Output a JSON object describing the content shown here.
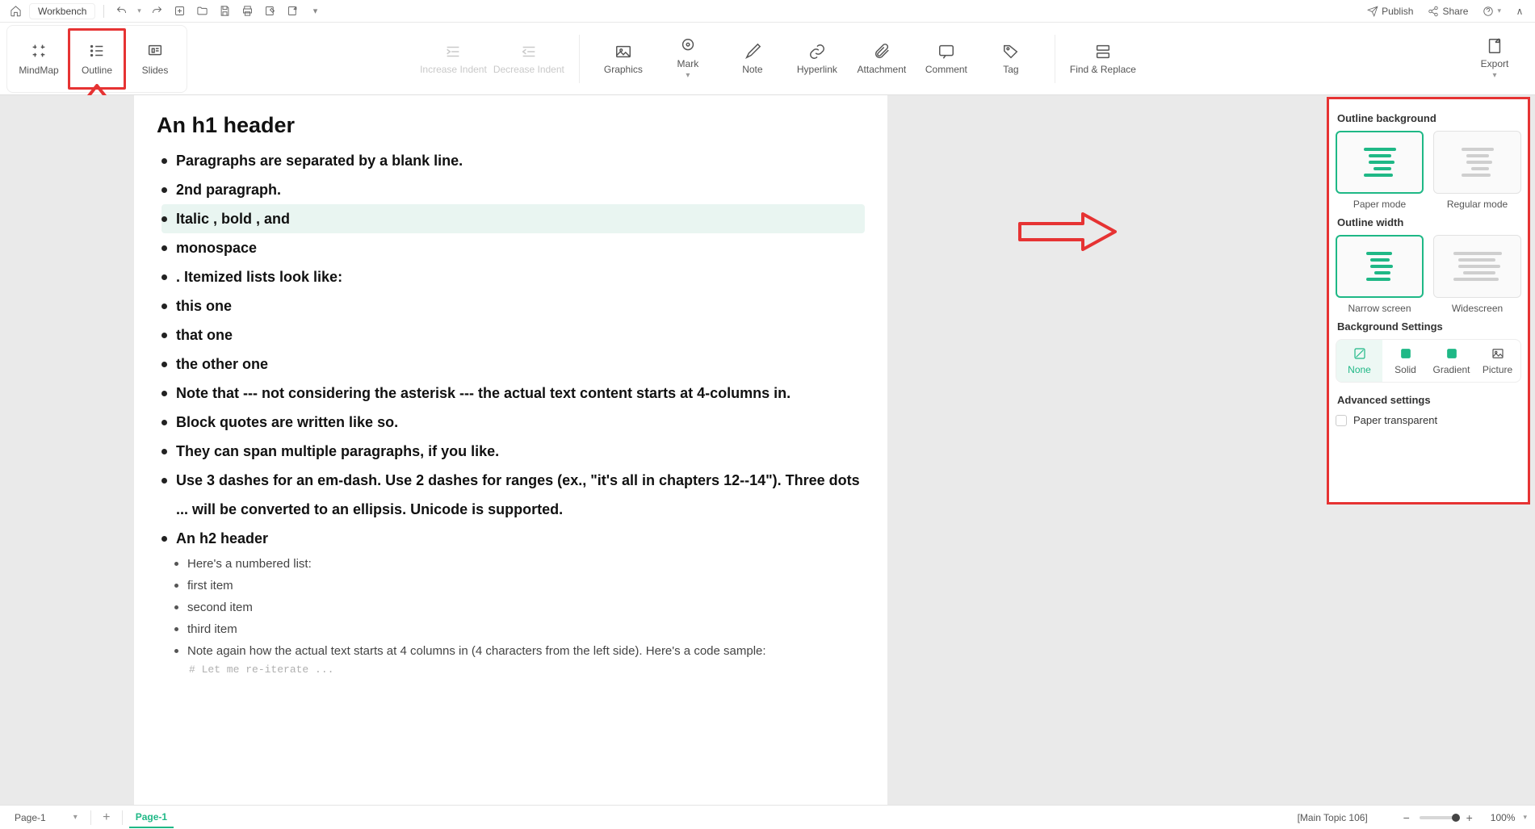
{
  "topbar": {
    "app_name": "Workbench",
    "publish": "Publish",
    "share": "Share"
  },
  "view_tabs": {
    "mindmap": "MindMap",
    "outline": "Outline",
    "slides": "Slides"
  },
  "ribbon": {
    "increase_indent": "Increase Indent",
    "decrease_indent": "Decrease Indent",
    "graphics": "Graphics",
    "mark": "Mark",
    "note": "Note",
    "hyperlink": "Hyperlink",
    "attachment": "Attachment",
    "comment": "Comment",
    "tag": "Tag",
    "find_replace": "Find & Replace",
    "export": "Export"
  },
  "document": {
    "h1": "An h1 header",
    "bullets": [
      "Paragraphs are separated by a blank line.",
      "2nd paragraph.",
      "Italic , bold , and",
      "monospace",
      ". Itemized lists look like:",
      "this one",
      "that one",
      "the other one",
      "Note that --- not considering the asterisk --- the actual text content starts at 4-columns in.",
      "Block quotes are written like so.",
      "They can span multiple paragraphs, if you like.",
      "Use 3 dashes for an em-dash. Use 2 dashes for ranges (ex., \"it's all in chapters 12--14\"). Three dots ... will be converted to an ellipsis. Unicode is supported.",
      "An h2 header"
    ],
    "subbullets": [
      "Here's a numbered list:",
      "first item",
      "second item",
      "third item",
      "Note again how the actual text starts at 4 columns in (4 characters from the left side). Here's a code sample:"
    ],
    "code_line": "# Let me re-iterate ..."
  },
  "panel": {
    "outline_bg_title": "Outline background",
    "paper_mode": "Paper mode",
    "regular_mode": "Regular mode",
    "outline_width_title": "Outline width",
    "narrow": "Narrow screen",
    "wide": "Widescreen",
    "bg_settings_title": "Background Settings",
    "bg_none": "None",
    "bg_solid": "Solid",
    "bg_gradient": "Gradient",
    "bg_picture": "Picture",
    "adv_title": "Advanced settings",
    "paper_transparent": "Paper transparent"
  },
  "status": {
    "page_selector": "Page-1",
    "page_tab": "Page-1",
    "context": "[Main Topic 106]",
    "zoom": "100%"
  }
}
